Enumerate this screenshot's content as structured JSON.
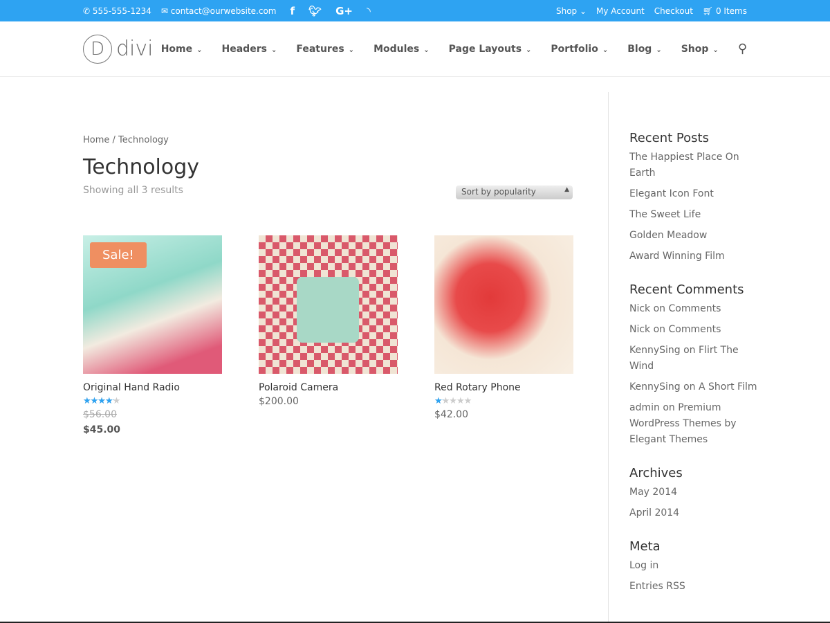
{
  "topbar": {
    "phone": "555-555-1234",
    "email": "contact@ourwebsite.com",
    "social": [
      "f",
      "t",
      "G+",
      "rss"
    ],
    "shop": "Shop",
    "account": "My Account",
    "checkout": "Checkout",
    "cart": "0 Items"
  },
  "header": {
    "logo": "divi",
    "nav": [
      "Home",
      "Headers",
      "Features",
      "Modules",
      "Page Layouts",
      "Portfolio",
      "Blog",
      "Shop"
    ]
  },
  "main": {
    "breadcrumb": "Home / Technology",
    "title": "Technology",
    "count": "Showing all 3 results",
    "sort": "Sort by popularity",
    "products": [
      {
        "name": "Original Hand Radio",
        "sale": "Sale!",
        "rating": 4.25,
        "old_price": "$56.00",
        "price": "$45.00"
      },
      {
        "name": "Polaroid Camera",
        "price": "$200.00"
      },
      {
        "name": "Red Rotary Phone",
        "rating": 1.25,
        "price": "$42.00"
      }
    ]
  },
  "sidebar": {
    "recent_posts": {
      "title": "Recent Posts",
      "items": [
        "The Happiest Place On Earth",
        "Elegant Icon Font",
        "The Sweet Life",
        "Golden Meadow",
        "Award Winning Film"
      ]
    },
    "recent_comments": {
      "title": "Recent Comments",
      "items": [
        "Nick on Comments",
        "Nick on Comments",
        "KennySing on Flirt The Wind",
        "KennySing on A Short Film",
        "admin on Premium WordPress Themes by Elegant Themes"
      ]
    },
    "archives": {
      "title": "Archives",
      "items": [
        "May 2014",
        "April 2014"
      ]
    },
    "meta": {
      "title": "Meta",
      "items": [
        "Log in",
        "Entries RSS"
      ]
    }
  },
  "colors": {
    "accent": "#2ea3f2",
    "sale": "#ef8f61"
  }
}
